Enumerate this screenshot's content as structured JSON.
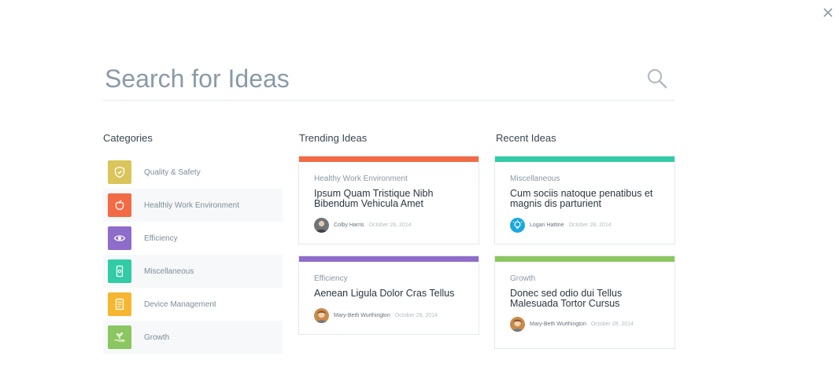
{
  "search": {
    "placeholder": "Search for Ideas"
  },
  "categories_section": {
    "title": "Categories",
    "items": [
      {
        "label": "Quality & Safety",
        "color": "#d9c55a",
        "icon": "shield-icon"
      },
      {
        "label": "Healthly Work Environment",
        "color": "#f26b45",
        "icon": "apple-icon"
      },
      {
        "label": "Efficiency",
        "color": "#8e6cc9",
        "icon": "eye-icon"
      },
      {
        "label": "Miscellaneous",
        "color": "#33cba6",
        "icon": "phone-icon"
      },
      {
        "label": "Device Management",
        "color": "#f5b731",
        "icon": "device-icon"
      },
      {
        "label": "Growth",
        "color": "#8cc660",
        "icon": "plant-hand-icon"
      }
    ]
  },
  "trending": {
    "title": "Trending Ideas",
    "cards": [
      {
        "category": "Healthy Work Environment",
        "title": "Ipsum Quam Tristique Nibh Bibendum Vehicula Amet",
        "author": "Colby Harris",
        "date": "October 28, 2014",
        "bar_color": "#f26b45"
      },
      {
        "category": "Efficiency",
        "title": "Aenean Ligula Dolor Cras Tellus",
        "author": "Mary-Beth Wurthington",
        "date": "October 28, 2014",
        "bar_color": "#8e6cc9"
      }
    ]
  },
  "recent": {
    "title": "Recent Ideas",
    "cards": [
      {
        "category": "Miscellaneous",
        "title": "Cum sociis natoque penatibus et magnis dis parturient",
        "author": "Logan Hattine",
        "date": "October 28, 2014",
        "bar_color": "#33cba6"
      },
      {
        "category": "Growth",
        "title": "Donec sed odio dui Tellus Malesuada Tortor Cursus",
        "author": "Mary-Beth Wurthington",
        "date": "October 28, 2014",
        "bar_color": "#8cc660"
      }
    ]
  }
}
